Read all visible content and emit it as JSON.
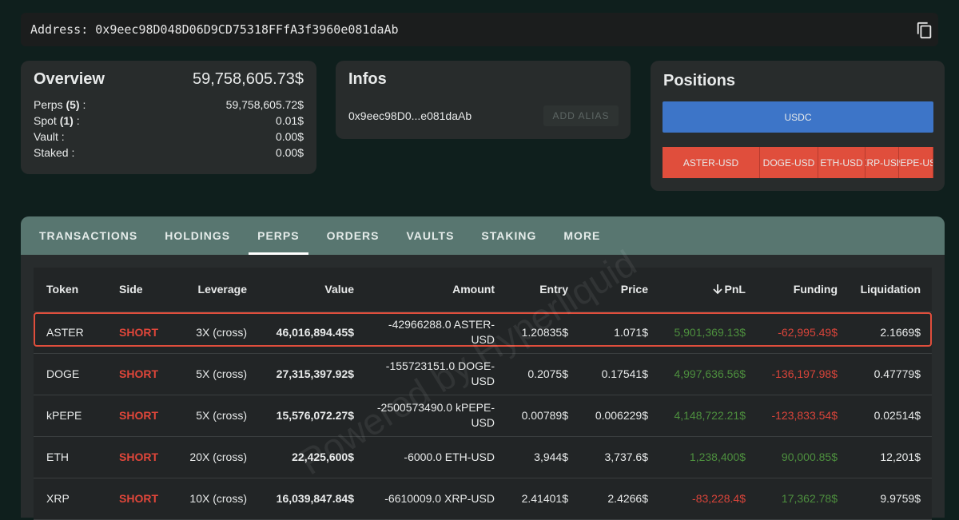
{
  "address": {
    "label": "Address: 0x9eec98D048D06D9CD75318FFfA3f3960e081daAb",
    "copy_icon": "copy-icon"
  },
  "overview": {
    "title": "Overview",
    "total": "59,758,605.73$",
    "rows": [
      {
        "label": "Perps",
        "count": "(5)",
        "sep": " :",
        "value": "59,758,605.72$"
      },
      {
        "label": "Spot",
        "count": "(1)",
        "sep": " :",
        "value": "0.01$"
      },
      {
        "label": "Vault :",
        "count": "",
        "sep": "",
        "value": "0.00$"
      },
      {
        "label": "Staked :",
        "count": "",
        "sep": "",
        "value": "0.00$"
      }
    ]
  },
  "infos": {
    "title": "Infos",
    "short_address": "0x9eec98D0...e081daAb",
    "add_alias": "ADD ALIAS"
  },
  "positions": {
    "title": "Positions",
    "spot": "USDC",
    "perps": [
      "ASTER-USD",
      "DOGE-USD",
      "ETH-USD",
      "XRP-USD",
      "kPEPE-USD"
    ],
    "colors": {
      "spot": "#3d75c8",
      "perps": "#e04e3c"
    }
  },
  "tabs": [
    "TRANSACTIONS",
    "HOLDINGS",
    "PERPS",
    "ORDERS",
    "VAULTS",
    "STAKING",
    "MORE"
  ],
  "active_tab": "PERPS",
  "table": {
    "headers": [
      "Token",
      "Side",
      "Leverage",
      "Value",
      "Amount",
      "Entry",
      "Price",
      "PnL",
      "Funding",
      "Liquidation"
    ],
    "sort_icon": "arrow-down-icon",
    "rows": [
      [
        "ASTER",
        "SHORT",
        "3X (cross)",
        "46,016,894.45$",
        "-42966288.0 ASTER-USD",
        "1.20835$",
        "1.071$",
        "5,901,369.13$",
        "-62,995.49$",
        "2.1669$"
      ],
      [
        "DOGE",
        "SHORT",
        "5X (cross)",
        "27,315,397.92$",
        "-155723151.0 DOGE-USD",
        "0.2075$",
        "0.17541$",
        "4,997,636.56$",
        "-136,197.98$",
        "0.47779$"
      ],
      [
        "kPEPE",
        "SHORT",
        "5X (cross)",
        "15,576,072.27$",
        "-2500573490.0 kPEPE-USD",
        "0.00789$",
        "0.006229$",
        "4,148,722.21$",
        "-123,833.54$",
        "0.02514$"
      ],
      [
        "ETH",
        "SHORT",
        "20X (cross)",
        "22,425,600$",
        "-6000.0 ETH-USD",
        "3,944$",
        "3,737.6$",
        "1,238,400$",
        "90,000.85$",
        "12,201$"
      ],
      [
        "XRP",
        "SHORT",
        "10X (cross)",
        "16,039,847.84$",
        "-6610009.0 XRP-USD",
        "2.41401$",
        "2.4266$",
        "-83,228.4$",
        "17,362.78$",
        "9.9759$"
      ]
    ]
  },
  "watermark": "Powered by Hyperliquid"
}
